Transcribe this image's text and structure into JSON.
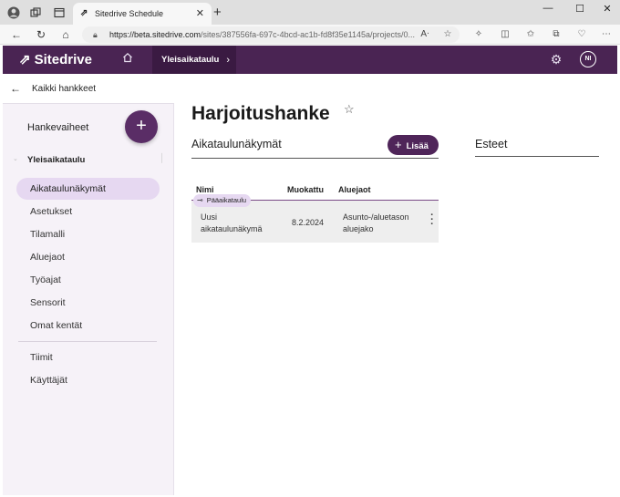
{
  "browser": {
    "tab_title": "Sitedrive Schedule",
    "url_host": "https://beta.sitedrive.com",
    "url_path": "/sites/387556fa-697c-4bcd-ac1b-fd8f35e1145a/projects/0..."
  },
  "header": {
    "brand": "Sitedrive",
    "breadcrumb": "Yleisaikataulu",
    "avatar_initials": "NI"
  },
  "sidebar": {
    "back_label": "Kaikki hankkeet",
    "phases_title": "Hankevaiheet",
    "section_title": "Yleisaikataulu",
    "items": [
      {
        "label": "Aikataulunäkymät"
      },
      {
        "label": "Asetukset"
      },
      {
        "label": "Tilamalli"
      },
      {
        "label": "Aluejaot"
      },
      {
        "label": "Työajat"
      },
      {
        "label": "Sensorit"
      },
      {
        "label": "Omat kentät"
      },
      {
        "label": "Tiimit"
      },
      {
        "label": "Käyttäjät"
      }
    ]
  },
  "main": {
    "title": "Harjoitushanke",
    "section_title": "Aikataulunäkymät",
    "add_label": "Lisää",
    "side_title": "Esteet",
    "table": {
      "headers": [
        "Nimi",
        "Muokattu",
        "Aluejaot"
      ],
      "rows": [
        {
          "badge": "Pääaikataulu",
          "name_line1": "Uusi",
          "name_line2": "aikataulunäkymä",
          "modified": "8.2.2024",
          "areas_line1": "Asunto-/aluetason",
          "areas_line2": "aluejako"
        }
      ]
    }
  },
  "colors": {
    "brand_header": "#4a2453",
    "accent_button": "#4f2559",
    "active_item": "#e6d8f1"
  }
}
